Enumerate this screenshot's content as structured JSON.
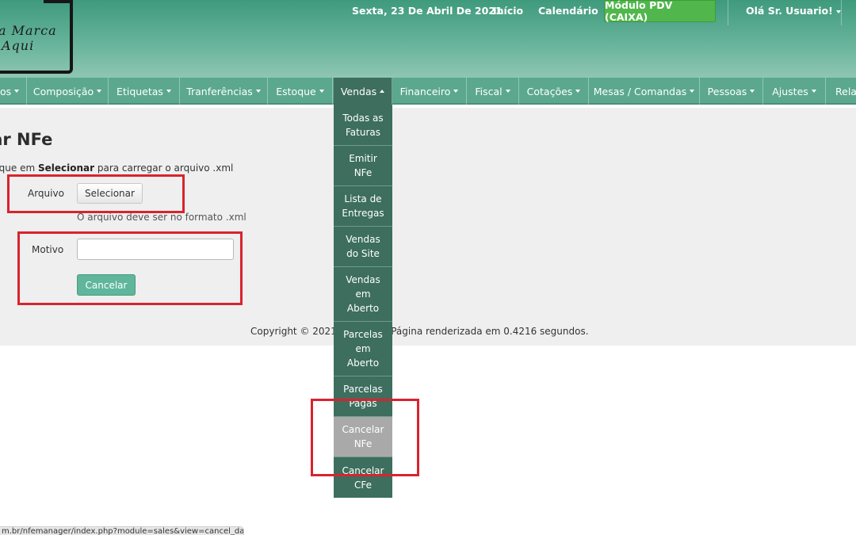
{
  "header": {
    "logo_line1": "a Marca",
    "logo_line2": "Aqui",
    "date": "Sexta, 23 De Abril De 2021",
    "inicio": "Início",
    "calendario": "Calendário",
    "pdv_button": "Módulo PDV (CAIXA)",
    "user_menu": "Olá Sr. Usuario!"
  },
  "nav": {
    "items": [
      {
        "label": "os"
      },
      {
        "label": "Composição"
      },
      {
        "label": "Etiquetas"
      },
      {
        "label": "Tranferências"
      },
      {
        "label": "Estoque"
      },
      {
        "label": "Vendas"
      },
      {
        "label": "Financeiro"
      },
      {
        "label": "Fiscal"
      },
      {
        "label": "Cotações"
      },
      {
        "label": "Mesas / Comandas"
      },
      {
        "label": "Pessoas"
      },
      {
        "label": "Ajustes"
      },
      {
        "label": "Rela"
      }
    ]
  },
  "dropdown": {
    "items": [
      {
        "label": "Todas as Faturas"
      },
      {
        "label": "Emitir NFe"
      },
      {
        "label": "Lista de Entregas"
      },
      {
        "label": "Vendas do Site"
      },
      {
        "label": "Vendas em Aberto"
      },
      {
        "label": "Parcelas em Aberto"
      },
      {
        "label": "Parcelas Pagas"
      },
      {
        "label": "Cancelar NFe"
      },
      {
        "label": "Cancelar CFe"
      }
    ],
    "selected": "Cancelar NFe"
  },
  "main": {
    "title": "lar NFe",
    "hint_before": "lique em ",
    "hint_bold": "Selecionar",
    "hint_after": " para carregar o arquivo .xml",
    "arquivo_label": "Arquivo",
    "select_button": "Selecionar",
    "file_note": "O arquivo deve ser no formato .xml",
    "motivo_label": "Motivo",
    "motivo_value": "",
    "cancel_button": "Cancelar"
  },
  "footer": {
    "copyright": "Copyright © 2021 Mar          v2.9 - Página renderizada em 0.4216 segundos."
  },
  "statusbar": {
    "url": "m.br/nfemanager/index.php?module=sales&view=cancel_danfe"
  },
  "colors": {
    "header_top": "#3f9a7c",
    "nav_bg": "#5ba88e",
    "nav_active": "#3d6e5e",
    "pdv_green": "#51b74d",
    "annotation_red": "#d9232e"
  }
}
